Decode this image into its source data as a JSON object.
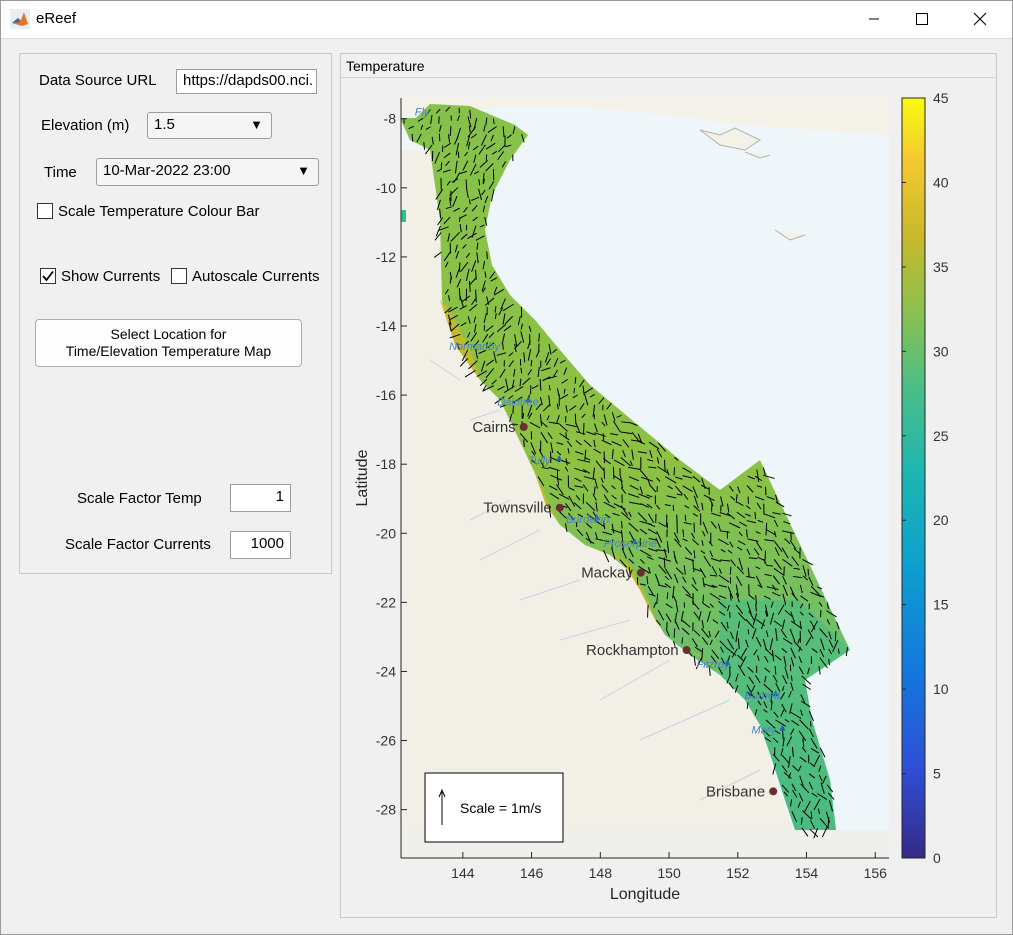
{
  "window": {
    "title": "eReef"
  },
  "controls": {
    "data_source_label": "Data Source URL",
    "data_source_value": "https://dapds00.nci.",
    "elevation_label": "Elevation (m)",
    "elevation_value": "1.5",
    "time_label": "Time",
    "time_value": "10-Mar-2022 23:00",
    "scale_temp_colourbar_label": "Scale Temperature Colour Bar",
    "scale_temp_colourbar_checked": false,
    "show_currents_label": "Show Currents",
    "show_currents_checked": true,
    "autoscale_currents_label": "Autoscale Currents",
    "autoscale_currents_checked": false,
    "select_location_line1": "Select Location for",
    "select_location_line2": "Time/Elevation Temperature Map",
    "scale_factor_temp_label": "Scale Factor Temp",
    "scale_factor_temp_value": "1",
    "scale_factor_currents_label": "Scale Factor Currents",
    "scale_factor_currents_value": "1000"
  },
  "plot_panel": {
    "title": "Temperature",
    "xlabel": "Longitude",
    "ylabel": "Latitude",
    "scale_legend": "Scale = 1m/s"
  },
  "chart_data": {
    "type": "heatmap",
    "xlabel": "Longitude",
    "ylabel": "Latitude",
    "xlim": [
      142.2,
      156.4
    ],
    "ylim": [
      -29.4,
      -7.4
    ],
    "x_ticks": [
      144,
      146,
      148,
      150,
      152,
      154,
      156
    ],
    "y_ticks": [
      -8,
      -10,
      -12,
      -14,
      -16,
      -18,
      -20,
      -22,
      -24,
      -26,
      -28
    ],
    "colorbar": {
      "min": 0,
      "max": 45,
      "ticks": [
        0,
        5,
        10,
        15,
        20,
        25,
        30,
        35,
        40,
        45
      ],
      "colormap": "parula"
    },
    "places": [
      {
        "name": "Cairns",
        "lon": 145.77,
        "lat": -16.92
      },
      {
        "name": "Townsville",
        "lon": 146.82,
        "lat": -19.26
      },
      {
        "name": "Mackay",
        "lon": 149.18,
        "lat": -21.14
      },
      {
        "name": "Rockhampton",
        "lon": 150.51,
        "lat": -23.38
      },
      {
        "name": "Brisbane",
        "lon": 153.03,
        "lat": -27.47
      }
    ],
    "rivers": [
      {
        "name": "Fly",
        "lon": 142.6,
        "lat": -7.9
      },
      {
        "name": "Normanby",
        "lon": 143.6,
        "lat": -14.7
      },
      {
        "name": "Daintree",
        "lon": 145.0,
        "lat": -16.3
      },
      {
        "name": "Tully",
        "lon": 145.9,
        "lat": -18.0
      },
      {
        "name": "Burdekin",
        "lon": 147.0,
        "lat": -19.7
      },
      {
        "name": "Proserpine",
        "lon": 148.1,
        "lat": -20.4
      },
      {
        "name": "Fitzroy",
        "lon": 150.8,
        "lat": -23.9
      },
      {
        "name": "Burnett",
        "lon": 152.2,
        "lat": -24.8
      },
      {
        "name": "Mary",
        "lon": 152.4,
        "lat": -25.8
      }
    ]
  },
  "colors": {
    "accent": "#0078d7",
    "arrow": "#000000",
    "land": "#f2f0e6",
    "sea": "#e8f4f8",
    "domain": "#7cc14a"
  }
}
